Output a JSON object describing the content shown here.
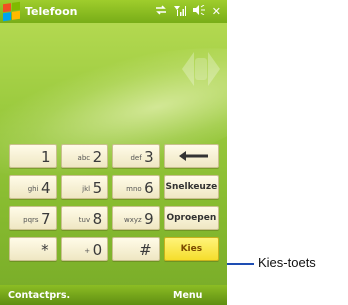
{
  "colors": {
    "accent": "#9acb3a",
    "kies_key": "#f5de2c",
    "callout": "#1e4db3"
  },
  "titlebar": {
    "title": "Telefoon",
    "icons": [
      "windows-start-icon",
      "connectivity-icon",
      "signal-strength-icon",
      "volume-icon",
      "close-icon"
    ],
    "close_glyph": "✕"
  },
  "nav_icon": "dialer-scroll-arrows-icon",
  "keypad": {
    "rows": [
      [
        {
          "sub": "",
          "num": "1"
        },
        {
          "sub": "abc",
          "num": "2"
        },
        {
          "sub": "def",
          "num": "3"
        },
        {
          "action": "backspace",
          "icon": "backspace-arrow-icon"
        }
      ],
      [
        {
          "sub": "ghi",
          "num": "4"
        },
        {
          "sub": "jkl",
          "num": "5"
        },
        {
          "sub": "mno",
          "num": "6"
        },
        {
          "action": "Snelkeuze"
        }
      ],
      [
        {
          "sub": "pqrs",
          "num": "7"
        },
        {
          "sub": "tuv",
          "num": "8"
        },
        {
          "sub": "wxyz",
          "num": "9"
        },
        {
          "action": "Oproepen"
        }
      ],
      [
        {
          "sub": "",
          "num": "*"
        },
        {
          "sub": "+",
          "num": "0"
        },
        {
          "sub": "",
          "num": "#"
        },
        {
          "action": "Kies"
        }
      ]
    ]
  },
  "menubar": {
    "left": "Contactprs.",
    "right": "Menu"
  },
  "callout": {
    "label": "Kies-toets"
  }
}
